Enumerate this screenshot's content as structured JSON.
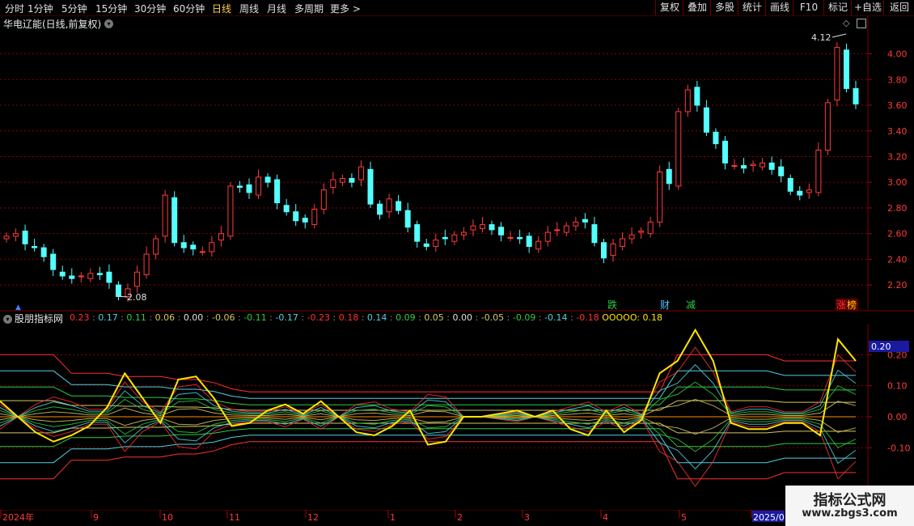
{
  "toolbar": {
    "periods": [
      "分时",
      "1分钟",
      "5分钟",
      "15分钟",
      "30分钟",
      "60分钟",
      "日线",
      "周线",
      "月线",
      "多周期",
      "更多 >"
    ],
    "active_period": "日线",
    "buttons": [
      "复权",
      "叠加",
      "多股",
      "统计",
      "画线",
      "F10",
      "标记",
      "+自选",
      "返回"
    ]
  },
  "main_chart": {
    "title": "华电辽能(日线,前复权)",
    "price_ticks": [
      "4.00",
      "3.80",
      "3.60",
      "3.40",
      "3.20",
      "3.00",
      "2.80",
      "2.60",
      "2.40",
      "2.20"
    ],
    "high_label": "4.12",
    "low_label": "2.08",
    "event_labels": [
      {
        "text": "跌",
        "color": "#2ecc40"
      },
      {
        "text": "财",
        "color": "#4fc3f7"
      },
      {
        "text": "减",
        "color": "#2ecc40"
      },
      {
        "text": "涨",
        "color": "#ff3030"
      },
      {
        "text": "榜",
        "color": "#ffcc00"
      }
    ]
  },
  "indicator": {
    "name": "股朋指标网",
    "values": [
      {
        "text": "0.23",
        "color": "#ff3030"
      },
      {
        "text": "0.17",
        "color": "#4fd1e0"
      },
      {
        "text": "0.11",
        "color": "#2ecc40"
      },
      {
        "text": "0.06",
        "color": "#d4c860"
      },
      {
        "text": "0.00",
        "color": "#e0e0e0"
      },
      {
        "text": "-0.06",
        "color": "#d4c860"
      },
      {
        "text": "-0.11",
        "color": "#2ecc40"
      },
      {
        "text": "-0.17",
        "color": "#4fd1e0"
      },
      {
        "text": "-0.23",
        "color": "#ff3030"
      },
      {
        "text": "0.18",
        "color": "#ff3030"
      },
      {
        "text": "0.14",
        "color": "#4fd1e0"
      },
      {
        "text": "0.09",
        "color": "#2ecc40"
      },
      {
        "text": "0.05",
        "color": "#d4c860"
      },
      {
        "text": "0.00",
        "color": "#e0e0e0"
      },
      {
        "text": "-0.05",
        "color": "#d4c860"
      },
      {
        "text": "-0.09",
        "color": "#2ecc40"
      },
      {
        "text": "-0.14",
        "color": "#4fd1e0"
      },
      {
        "text": "-0.18",
        "color": "#ff3030"
      }
    ],
    "main_label": "OOOOO:",
    "main_value": "0.18",
    "ticks": [
      "0.20",
      "0.10",
      "0.00",
      "-0.10"
    ],
    "current_tag": "0.20"
  },
  "time_axis": [
    "2024年",
    "9",
    "10",
    "11",
    "12",
    "1",
    "2",
    "3",
    "4",
    "5",
    "2025/0"
  ],
  "watermark": {
    "line1": "指标公式网",
    "line2": "www.zbgs3.com"
  },
  "chart_data": [
    {
      "type": "candlestick",
      "title": "华电辽能(日线,前复权)",
      "x": [
        "2024年",
        "9",
        "10",
        "11",
        "12",
        "1",
        "2",
        "3",
        "4",
        "5"
      ],
      "closes": [
        2.58,
        2.6,
        2.52,
        2.49,
        2.42,
        2.32,
        2.27,
        2.25,
        2.27,
        2.29,
        2.28,
        2.22,
        2.11,
        2.17,
        2.3,
        2.44,
        2.56,
        2.9,
        2.53,
        2.49,
        2.48,
        2.46,
        2.53,
        2.6,
        2.97,
        2.96,
        2.92,
        3.04,
        3.0,
        2.84,
        2.77,
        2.7,
        2.69,
        2.79,
        2.94,
        3.02,
        3.03,
        3.0,
        3.12,
        2.83,
        2.75,
        2.87,
        2.78,
        2.65,
        2.54,
        2.5,
        2.55,
        2.56,
        2.59,
        2.61,
        2.66,
        2.67,
        2.63,
        2.59,
        2.57,
        2.56,
        2.5,
        2.54,
        2.61,
        2.63,
        2.66,
        2.69,
        2.69,
        2.53,
        2.41,
        2.52,
        2.56,
        2.59,
        2.62,
        2.69,
        3.08,
        2.99,
        3.55,
        3.72,
        3.6,
        3.39,
        3.3,
        3.15,
        3.13,
        3.11,
        3.14,
        3.15,
        3.1,
        3.05,
        2.93,
        2.9,
        2.94,
        3.25,
        3.62,
        4.05,
        3.73,
        3.61
      ],
      "ylim": [
        2.1,
        4.18
      ],
      "ticks": [
        4.0,
        3.8,
        3.6,
        3.4,
        3.2,
        3.0,
        2.8,
        2.6,
        2.4,
        2.2
      ],
      "annotations": [
        {
          "text": "4.12",
          "value": 4.12
        },
        {
          "text": "2.08",
          "value": 2.08
        }
      ]
    },
    {
      "type": "line",
      "title": "股朋指标网",
      "ylim": [
        -0.3,
        0.3
      ],
      "ticks": [
        0.2,
        0.1,
        0.0,
        -0.1
      ],
      "series": [
        {
          "name": "OOOOO",
          "color": "#ffe600",
          "values": [
            0.05,
            0.0,
            -0.05,
            -0.08,
            -0.06,
            -0.03,
            0.03,
            0.14,
            0.06,
            -0.02,
            0.12,
            0.13,
            0.06,
            -0.03,
            -0.02,
            0.02,
            0.04,
            0.01,
            0.05,
            0.0,
            -0.05,
            -0.06,
            -0.03,
            0.02,
            -0.09,
            -0.08,
            0.0,
            0.0,
            0.01,
            0.02,
            0.0,
            0.02,
            -0.04,
            -0.06,
            0.02,
            -0.05,
            -0.01,
            0.14,
            0.18,
            0.28,
            0.18,
            -0.02,
            -0.04,
            -0.04,
            -0.02,
            -0.02,
            -0.06,
            0.25,
            0.18
          ]
        },
        {
          "name": "upper",
          "color": "#ff3030",
          "values": [
            0.2,
            0.2,
            0.2,
            0.2,
            0.14,
            0.14,
            0.14,
            0.13,
            0.13,
            0.13,
            0.12,
            0.12,
            0.11,
            0.09,
            0.08,
            0.08,
            0.08,
            0.08,
            0.08,
            0.08,
            0.08,
            0.08,
            0.08,
            0.08,
            0.08,
            0.08,
            0.08,
            0.08,
            0.08,
            0.08,
            0.08,
            0.08,
            0.08,
            0.08,
            0.08,
            0.08,
            0.08,
            0.08,
            0.2,
            0.2,
            0.2,
            0.2,
            0.2,
            0.2,
            0.18,
            0.18,
            0.18,
            0.18,
            0.18
          ]
        }
      ]
    }
  ]
}
